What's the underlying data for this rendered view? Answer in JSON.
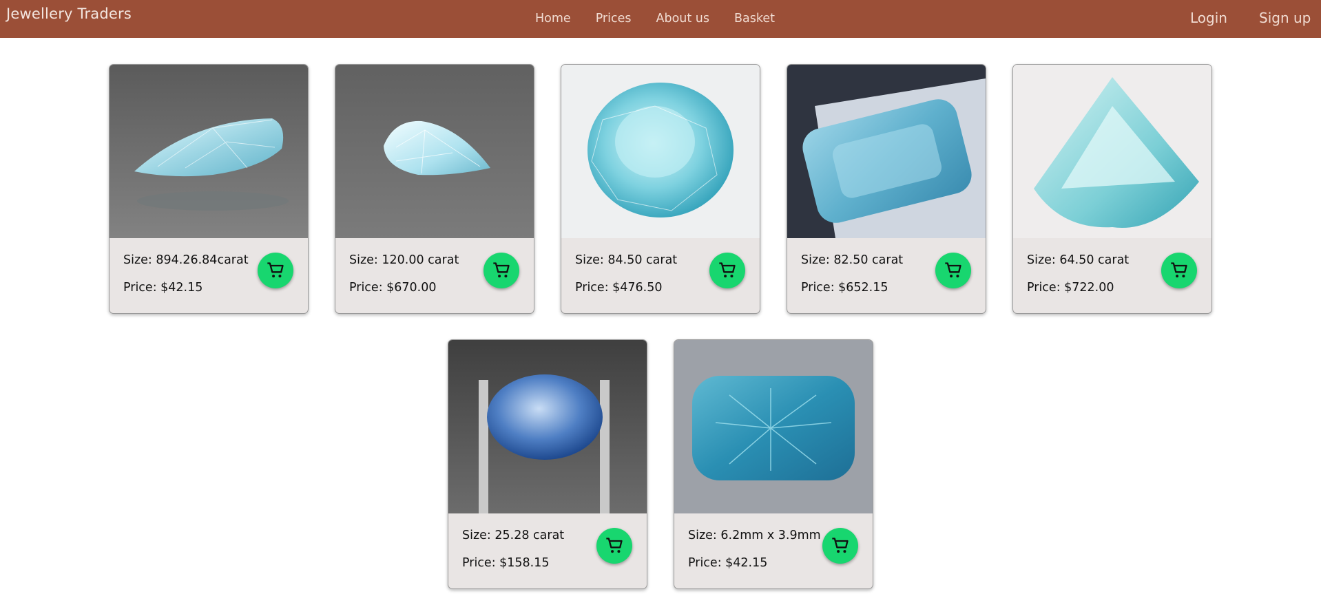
{
  "header": {
    "brand": "Jewellery Traders",
    "nav": [
      "Home",
      "Prices",
      "About us",
      "Basket"
    ],
    "auth": [
      "Login",
      "Sign up"
    ]
  },
  "cart_icon": "shopping-cart-icon",
  "colors": {
    "header_bg": "#9b4f37",
    "card_bg": "#e9e5e4",
    "cart_button": "#18d66f"
  },
  "products": [
    {
      "size": "Size: 894.26.84carat",
      "price": "Price: $42.15",
      "image": "pear-aquamarine-photo"
    },
    {
      "size": "Size: 120.00 carat",
      "price": "Price: $670.00",
      "image": "pear-aquamarine-photo"
    },
    {
      "size": "Size: 84.50 carat",
      "price": "Price: $476.50",
      "image": "oval-aquamarine-photo"
    },
    {
      "size": "Size: 82.50 carat",
      "price": "Price: $652.15",
      "image": "cushion-aquamarine-photo"
    },
    {
      "size": "Size: 64.50 carat",
      "price": "Price: $722.00",
      "image": "trillion-aquamarine-photo"
    },
    {
      "size": "Size: 25.28 carat",
      "price": "Price: $158.15",
      "image": "oval-blue-gem-photo"
    },
    {
      "size": "Size: 6.2mm x 3.9mm",
      "price": "Price: $42.15",
      "image": "concave-cut-aquamarine-photo"
    }
  ]
}
